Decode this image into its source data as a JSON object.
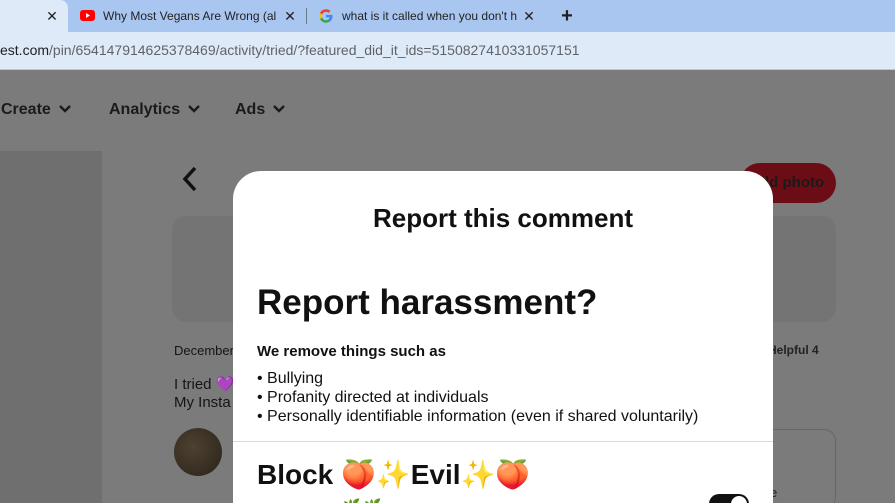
{
  "browser": {
    "tabs": [
      {
        "title": "",
        "active": true
      },
      {
        "title": "Why Most Vegans Are Wrong (al",
        "favicon": "youtube-icon"
      },
      {
        "title": "what is it called when you don't h",
        "favicon": "google-icon"
      }
    ],
    "close_glyph": "✕",
    "new_tab_glyph": "+",
    "url_host": "est.com",
    "url_path": "/pin/654147914625378469/activity/tried/?featured_did_it_ids=5150827410331057151"
  },
  "page": {
    "nav": [
      {
        "label": "Create"
      },
      {
        "label": "Analytics"
      },
      {
        "label": "Ads"
      }
    ],
    "back_glyph": "‹",
    "add_photo_label": "dd photo",
    "date_text": "December",
    "helpful_text": "Helpful 4",
    "tried_text": "I tried 💜",
    "insta_text": "My Insta",
    "card_text": "e"
  },
  "modal": {
    "title": "Report this comment",
    "section_title": "Report harassment?",
    "remove_label": "We remove things such as",
    "bullets": [
      "• Bullying",
      "• Profanity directed at individuals",
      "• Personally identifiable information (even if shared voluntarily)"
    ],
    "block_title": "Block 🍑✨Evil✨🍑",
    "block_subtitle": "🌿 🌿",
    "toggle_on": true
  },
  "colors": {
    "tabstrip": "#a9c6f1",
    "active_tab": "#dfeaf9",
    "overlay": "#7b7b7b",
    "add_photo": "#6c0d15",
    "youtube_red": "#ff0000"
  }
}
